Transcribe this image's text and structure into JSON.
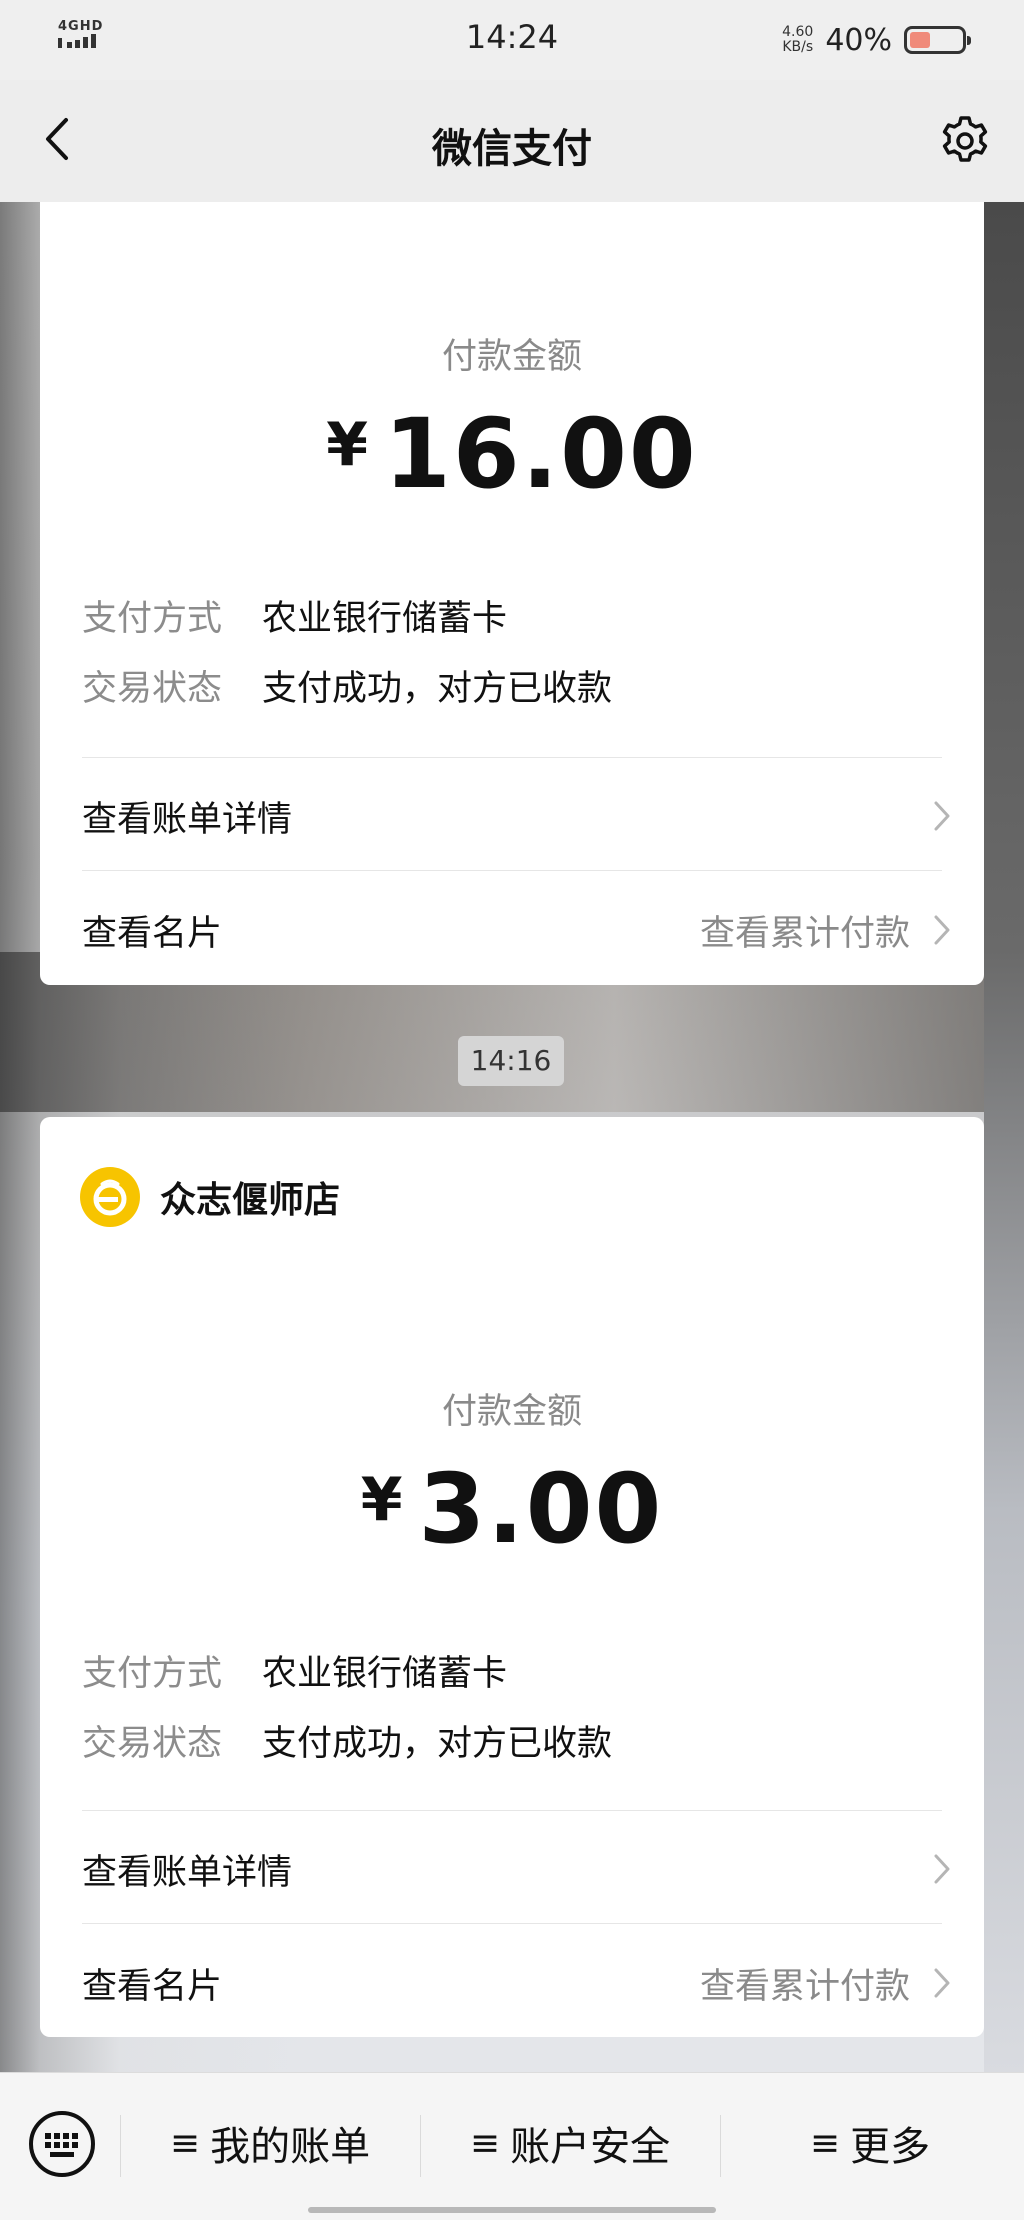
{
  "status_bar": {
    "network": "4GHD",
    "time": "14:24",
    "speed_value": "4.60",
    "speed_unit": "KB/s",
    "battery": "40%",
    "battery_level": 0.4
  },
  "nav": {
    "title": "微信支付",
    "back_icon": "chevron-left-icon",
    "settings_icon": "gear-icon"
  },
  "payments": [
    {
      "merchant": "",
      "amount_label": "付款金额",
      "currency": "¥",
      "amount": "16.00",
      "method_label": "支付方式",
      "method_value": "农业银行储蓄卡",
      "status_label": "交易状态",
      "status_value": "支付成功，对方已收款",
      "detail_link": "查看账单详情",
      "card_link": "查看名片",
      "cumulative_link": "查看累计付款"
    },
    {
      "merchant": "众志偃师店",
      "amount_label": "付款金额",
      "currency": "¥",
      "amount": "3.00",
      "method_label": "支付方式",
      "method_value": "农业银行储蓄卡",
      "status_label": "交易状态",
      "status_value": "支付成功，对方已收款",
      "detail_link": "查看账单详情",
      "card_link": "查看名片",
      "cumulative_link": "查看累计付款"
    }
  ],
  "chat_time": "14:16",
  "bottom_menu": {
    "keyboard_icon": "keyboard-icon",
    "items": [
      {
        "icon": "≡",
        "label": "我的账单"
      },
      {
        "icon": "≡",
        "label": "账户安全"
      },
      {
        "icon": "≡",
        "label": "更多"
      }
    ]
  },
  "colors": {
    "merchant_logo": "#f7c400",
    "battery_fill": "#f08a7a",
    "secondary_text": "#8a8a8a"
  }
}
